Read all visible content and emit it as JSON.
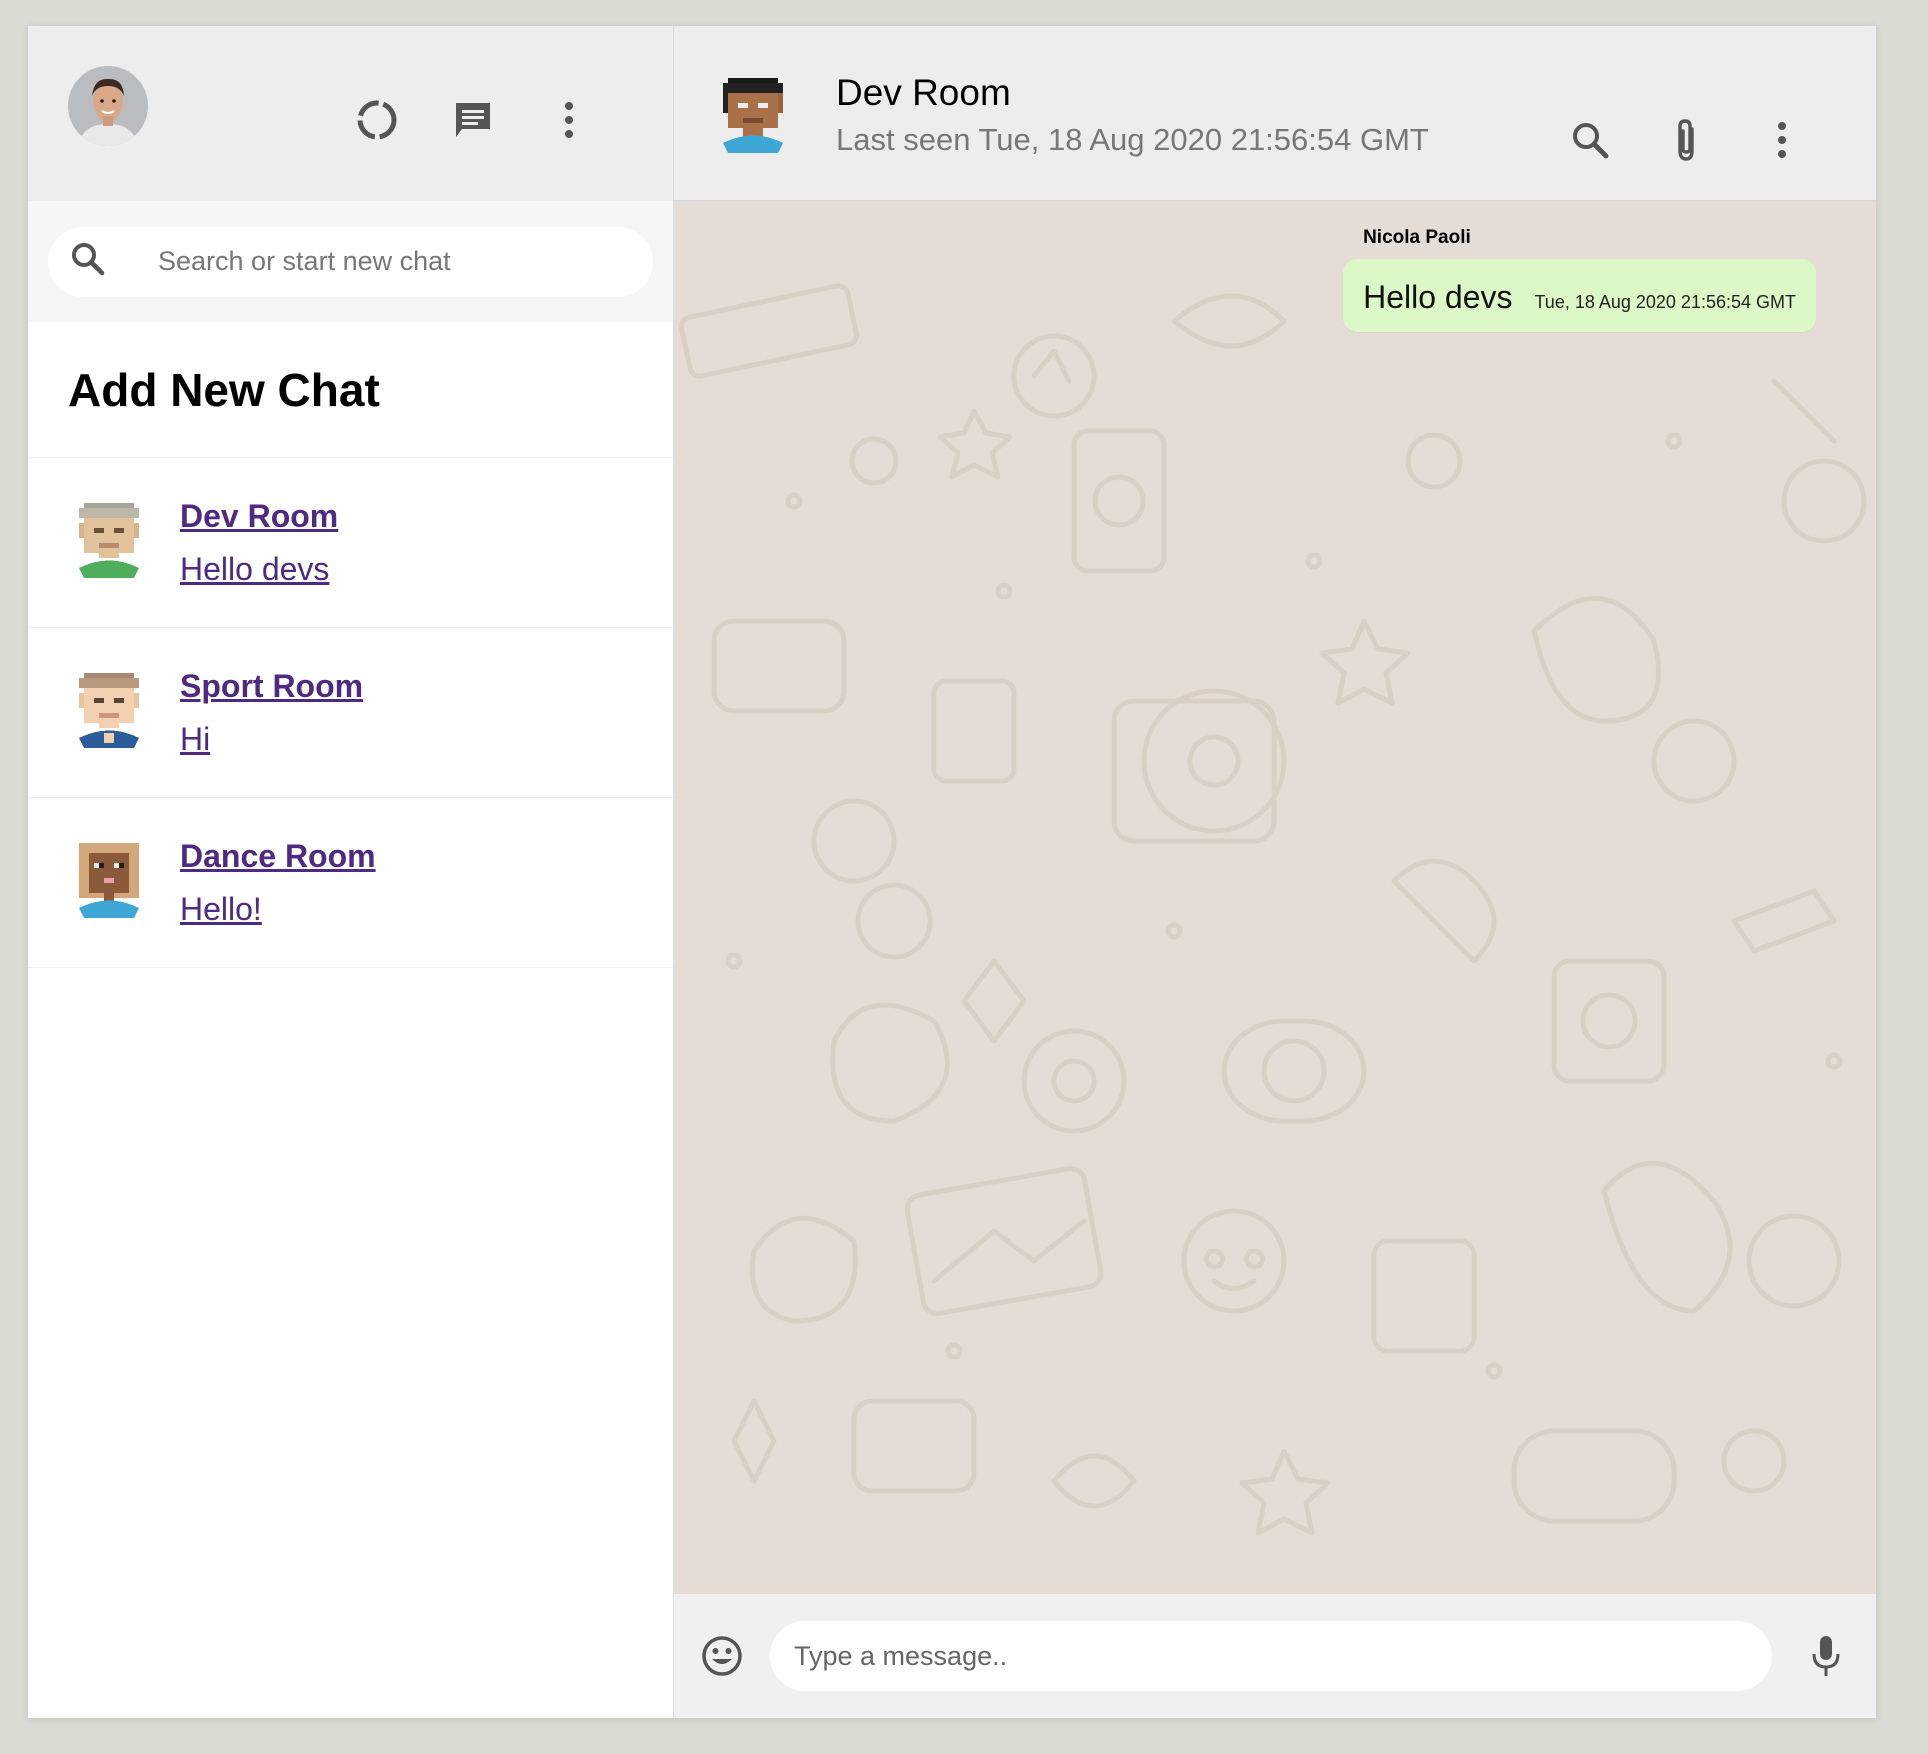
{
  "sidebar": {
    "user_avatar": "profile-photo",
    "icons": [
      "status-icon",
      "chat-icon",
      "more-vert-icon"
    ],
    "search": {
      "placeholder": "Search or start new chat"
    },
    "add_chat_label": "Add New Chat",
    "chats": [
      {
        "name": "Dev Room",
        "last_message": "Hello devs",
        "avatar": "pixel-avatar-green"
      },
      {
        "name": "Sport Room",
        "last_message": "Hi",
        "avatar": "pixel-avatar-blue"
      },
      {
        "name": "Dance Room",
        "last_message": "Hello!",
        "avatar": "pixel-avatar-cyan"
      }
    ]
  },
  "chat": {
    "header": {
      "room_name": "Dev Room",
      "last_seen": "Last seen Tue, 18 Aug 2020 21:56:54 GMT",
      "icons": [
        "search-icon",
        "attach-icon",
        "more-vert-icon"
      ]
    },
    "messages": [
      {
        "sender": "Nicola Paoli",
        "text": "Hello devs",
        "timestamp": "Tue, 18 Aug 2020 21:56:54 GMT"
      }
    ],
    "footer": {
      "placeholder": "Type a message..",
      "icons": [
        "emoji-icon",
        "mic-icon"
      ]
    }
  },
  "colors": {
    "header_bg": "#ededed",
    "chat_bg": "#e5ddd5",
    "bubble_bg": "#dcf8c6",
    "link": "#4e2a84"
  }
}
